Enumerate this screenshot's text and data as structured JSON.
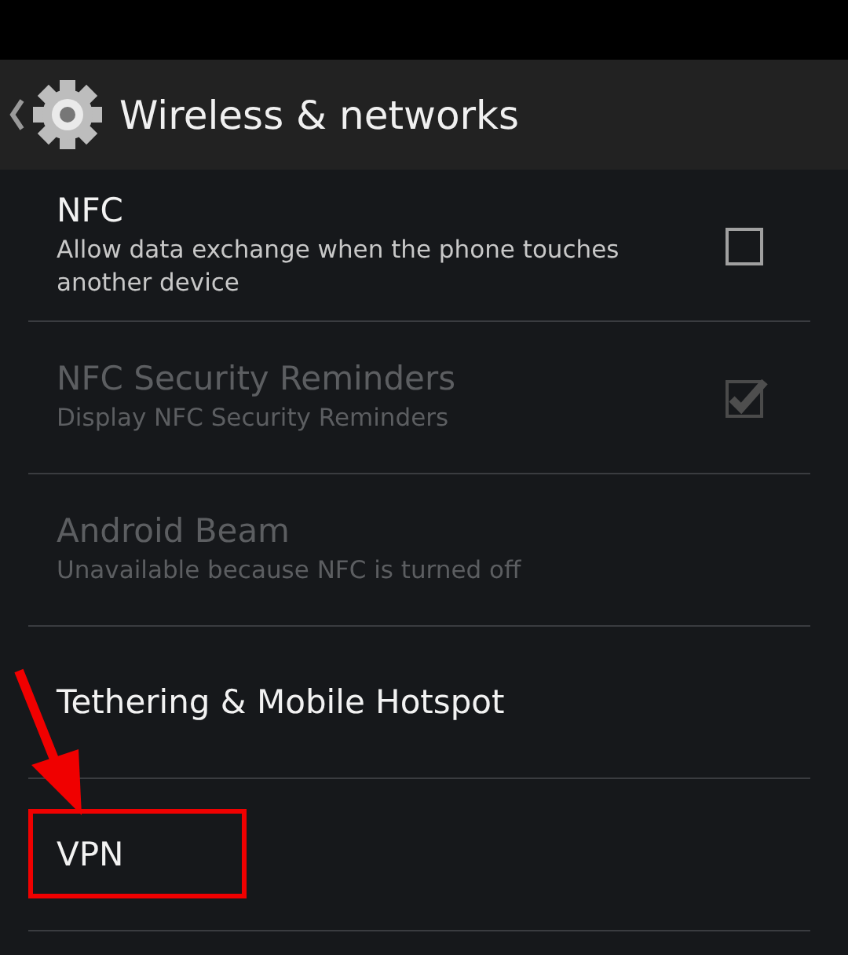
{
  "action_bar": {
    "title": "Wireless & networks"
  },
  "items": [
    {
      "kind": "checkbox",
      "title": "NFC",
      "summary": "Allow data exchange when the phone touches another device",
      "checked": false,
      "disabled": false,
      "highlighted": false
    },
    {
      "kind": "checkbox",
      "title": "NFC Security Reminders",
      "summary": "Display NFC Security Reminders",
      "checked": true,
      "disabled": true,
      "highlighted": false
    },
    {
      "kind": "plain",
      "title": "Android Beam",
      "summary": "Unavailable because NFC is turned off",
      "disabled": true,
      "highlighted": false
    },
    {
      "kind": "plain",
      "title": "Tethering & Mobile Hotspot",
      "disabled": false,
      "highlighted": false
    },
    {
      "kind": "plain",
      "title": "VPN",
      "disabled": false,
      "highlighted": true
    }
  ]
}
